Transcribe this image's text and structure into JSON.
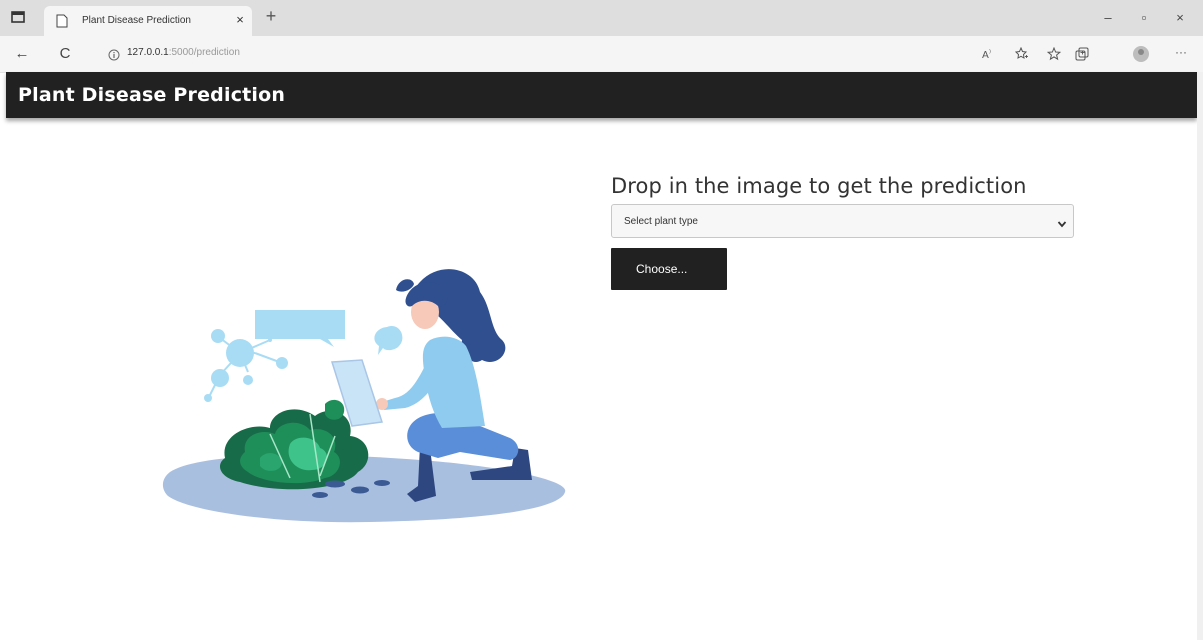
{
  "browser": {
    "tab_title": "Plant Disease Prediction",
    "tab_close": "×",
    "new_tab": "+",
    "url_host": "127.0.0.1",
    "url_rest": ":5000/prediction",
    "window_minimize": "–",
    "window_restore": "▫",
    "window_close": "×",
    "back": "←",
    "reload": "C",
    "more_menu": "···"
  },
  "navbar": {
    "brand": "Plant Disease Prediction"
  },
  "main": {
    "heading": "Drop in the image to get the prediction",
    "plant_select": {
      "selected": "Select plant type"
    },
    "choose_button": "Choose..."
  },
  "colors": {
    "navbar_bg": "#212121",
    "button_bg": "#212121",
    "accent_light_blue": "#a8dcf5",
    "leaf_green": "#1f8f5a"
  }
}
